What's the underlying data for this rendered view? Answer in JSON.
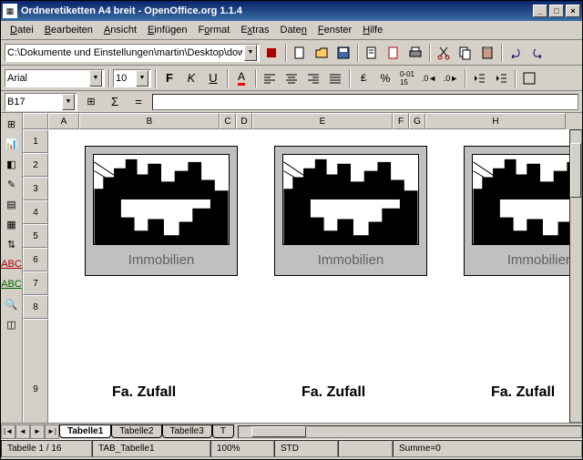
{
  "window": {
    "title": "Ordneretiketten A4 breit - OpenOffice.org 1.1.4"
  },
  "menu": {
    "file": "Datei",
    "edit": "Bearbeiten",
    "view": "Ansicht",
    "insert": "Einfügen",
    "format": "Format",
    "extras": "Extras",
    "data": "Daten",
    "window": "Fenster",
    "help": "Hilfe"
  },
  "path": {
    "value": "C:\\Dokumente und Einstellungen\\martin\\Desktop\\downloa"
  },
  "font": {
    "name": "Arial",
    "size": "10"
  },
  "cellref": {
    "value": "B17"
  },
  "columns": [
    "A",
    "B",
    "C",
    "D",
    "E",
    "F",
    "G",
    "H"
  ],
  "rows": [
    "1",
    "2",
    "3",
    "4",
    "5",
    "6",
    "7",
    "8",
    "9"
  ],
  "labels": {
    "immo": "Immobilien",
    "company": "Fa. Zufall"
  },
  "sheets": {
    "t1": "Tabelle1",
    "t2": "Tabelle2",
    "t3": "Tabelle3",
    "t4": "T"
  },
  "status": {
    "sheet": "Tabelle 1 / 16",
    "tab": "TAB_Tabelle1",
    "zoom": "100%",
    "std": "STD",
    "sum": "Summe=0"
  }
}
